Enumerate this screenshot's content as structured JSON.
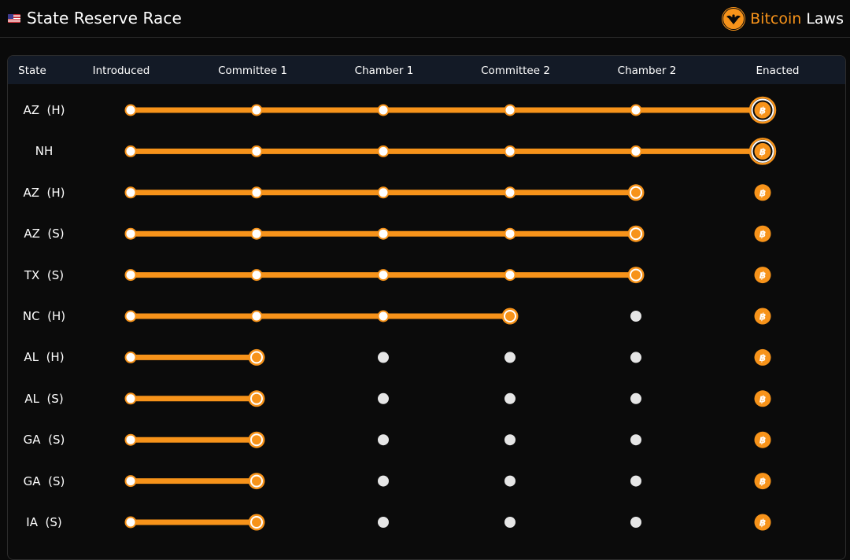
{
  "header": {
    "title": "State Reserve Race",
    "flag_icon": "us-flag-icon",
    "brand_logo_icon": "eagle-seal-icon",
    "brand_part1": "Bitcoin",
    "brand_part2": "Laws"
  },
  "colors": {
    "accent": "#f7931a",
    "header_bg": "#131a26",
    "inactive_dot": "#e6e6e6",
    "background": "#0a0a0a"
  },
  "columns": [
    "State",
    "Introduced",
    "Committee 1",
    "Chamber 1",
    "Committee 2",
    "Chamber 2",
    "Enacted"
  ],
  "rows": [
    {
      "state": "AZ  (H)",
      "stage": 6
    },
    {
      "state": "NH",
      "stage": 6
    },
    {
      "state": "AZ  (H)",
      "stage": 5
    },
    {
      "state": "AZ  (S)",
      "stage": 5
    },
    {
      "state": "TX  (S)",
      "stage": 5
    },
    {
      "state": "NC  (H)",
      "stage": 4
    },
    {
      "state": "AL  (H)",
      "stage": 2
    },
    {
      "state": "AL  (S)",
      "stage": 2
    },
    {
      "state": "GA  (S)",
      "stage": 2
    },
    {
      "state": "GA  (S)",
      "stage": 2
    },
    {
      "state": "IA  (S)",
      "stage": 2
    }
  ]
}
